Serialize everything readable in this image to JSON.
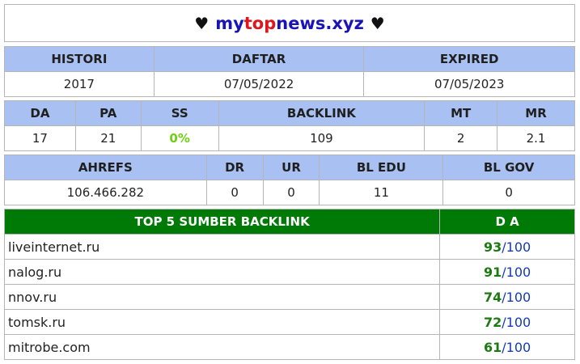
{
  "title": {
    "heart_left": "♥",
    "heart_right": "♥",
    "part1": "my",
    "part2": "top",
    "part3": "news.xyz"
  },
  "row1": {
    "headers": [
      "HISTORI",
      "DAFTAR",
      "EXPIRED"
    ],
    "values": [
      "2017",
      "07/05/2022",
      "07/05/2023"
    ]
  },
  "row2": {
    "headers": [
      "DA",
      "PA",
      "SS",
      "BACKLINK",
      "MT",
      "MR"
    ],
    "values": [
      "17",
      "21",
      "0%",
      "109",
      "2",
      "2.1"
    ]
  },
  "row3": {
    "headers": [
      "AHREFS",
      "DR",
      "UR",
      "BL EDU",
      "BL GOV"
    ],
    "values": [
      "106.466.282",
      "0",
      "0",
      "11",
      "0"
    ]
  },
  "backlinks": {
    "header_source": "TOP 5 SUMBER BACKLINK",
    "header_da": "D A",
    "max_label": "100",
    "separator": "/",
    "rows": [
      {
        "site": "liveinternet.ru",
        "da": "93"
      },
      {
        "site": "nalog.ru",
        "da": "91"
      },
      {
        "site": "nnov.ru",
        "da": "74"
      },
      {
        "site": "tomsk.ru",
        "da": "72"
      },
      {
        "site": "mitrobe.com",
        "da": "61"
      }
    ]
  },
  "colors": {
    "header_blue": "#a9c1f2",
    "header_green": "#007a07",
    "title_blue": "#1a14b8",
    "title_red": "#e0161d",
    "ss_green": "#6fcf14",
    "da_green": "#1d7a12"
  }
}
